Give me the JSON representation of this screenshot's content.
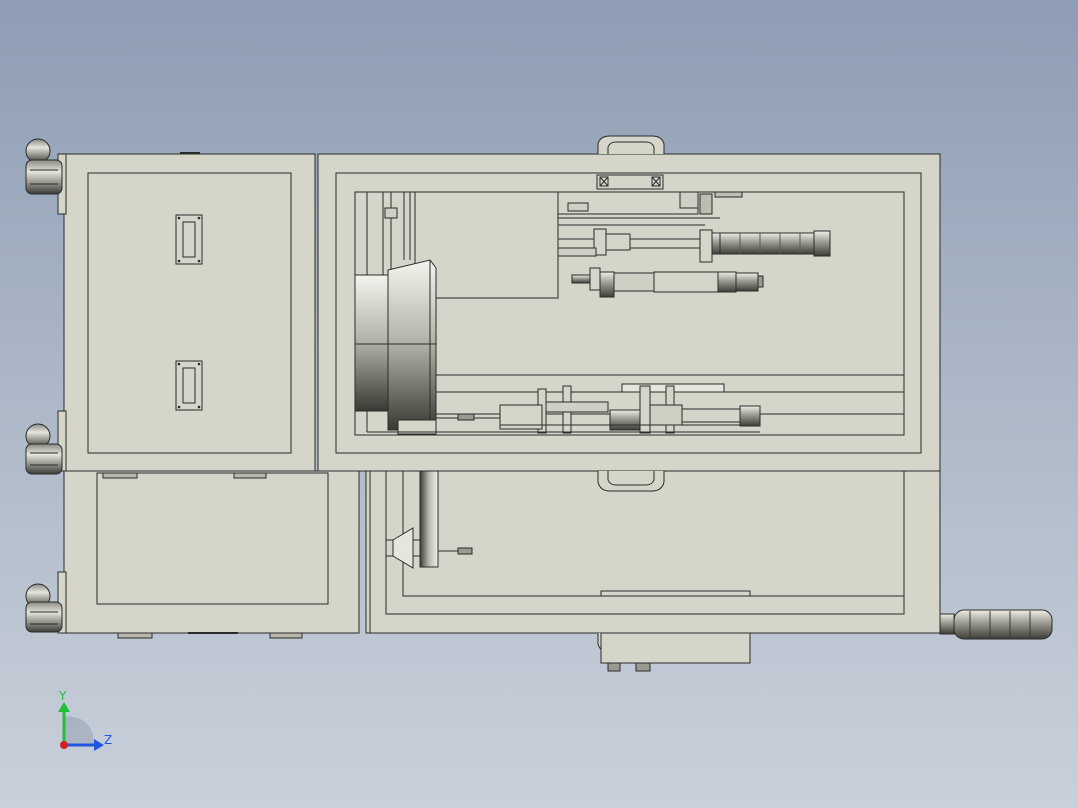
{
  "view": {
    "background_top": "#8e9db4",
    "background_bottom": "#c9d0da",
    "part_fill": "#d6d5c9",
    "edge_color": "#2b2b2b",
    "shaded_part_dark": "#5a5a52",
    "shaded_part_light": "#e8e8e0"
  },
  "triad": {
    "y_label": "Y",
    "z_label": "Z",
    "y_color": "#1fbf3a",
    "z_color": "#2156e0",
    "x_color": "#d82020"
  }
}
